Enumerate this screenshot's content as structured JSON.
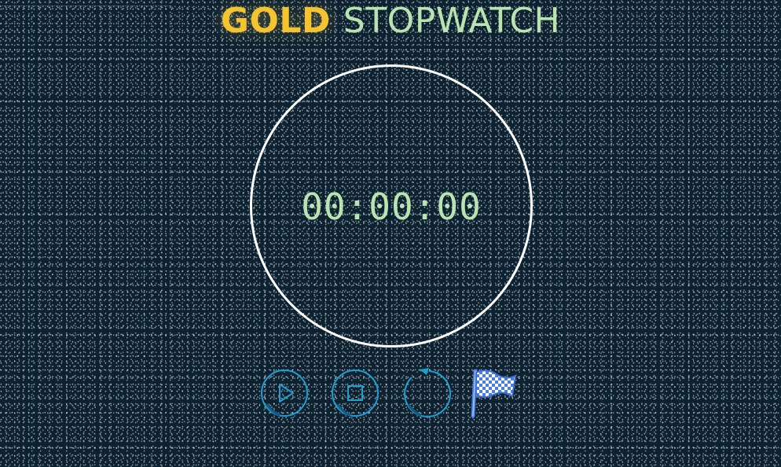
{
  "header": {
    "title_highlight": "GOLD",
    "title_rest": "STOPWATCH"
  },
  "timer": {
    "display": "00:00:00"
  },
  "controls": {
    "play_icon": "play-icon",
    "stop_icon": "stop-icon",
    "reset_icon": "reset-icon",
    "lap_icon": "checkered-flag-icon"
  },
  "colors": {
    "background": "#0c2231",
    "gold": "#f4c430",
    "mint": "#b9e4b0",
    "control_blue": "#1e9fd3",
    "dial": "#ffffff",
    "flag": "#5b8de8"
  }
}
